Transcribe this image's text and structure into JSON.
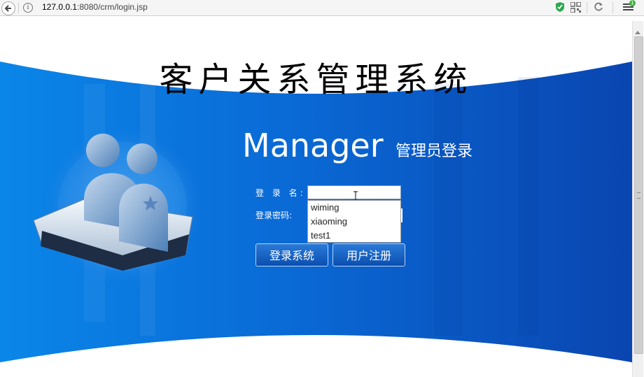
{
  "browser": {
    "url_host": "127.0.0.1",
    "url_path": ":8080/crm/login.jsp",
    "badge": "1"
  },
  "page": {
    "site_title": "客户关系管理系统",
    "heading": "Manager",
    "heading_sub": "管理员登录"
  },
  "form": {
    "username_label": "登 录 名:",
    "username_value": "",
    "password_label": "登录密码:",
    "autocomplete": [
      "wiming",
      "xiaoming",
      "test1"
    ],
    "login_button": "登录系统",
    "register_button": "用户注册"
  },
  "colors": {
    "brand_blue": "#0b5fc8",
    "accent": "#2a7ad8"
  },
  "icons": [
    "back-arrow-icon",
    "info-icon",
    "shield-icon",
    "qr-code-icon",
    "refresh-icon",
    "menu-icon",
    "users-illustration"
  ]
}
